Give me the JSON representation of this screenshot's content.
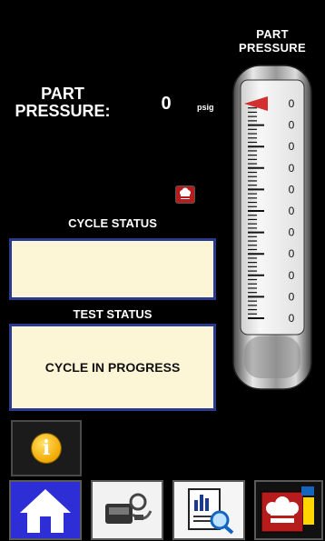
{
  "gauge": {
    "title_line1": "PART",
    "title_line2": "PRESSURE",
    "scale_labels": [
      "0",
      "0",
      "0",
      "0",
      "0",
      "0",
      "0",
      "0",
      "0",
      "0",
      "0"
    ]
  },
  "part_pressure": {
    "label_line1": "PART",
    "label_line2": "PRESSURE:",
    "value": "0",
    "unit": "psig"
  },
  "cycle_status": {
    "label": "CYCLE STATUS",
    "value": ""
  },
  "test_status": {
    "label": "TEST STATUS",
    "value": "CYCLE IN PROGRESS"
  },
  "colors": {
    "background": "#000000",
    "status_box_fill": "#fdf6d6",
    "status_box_border": "#2a3a8f",
    "gauge_pointer": "#d32f2f",
    "info_icon": "#f2a900",
    "home_button": "#2e2ed6",
    "chef_icon": "#b71c1c"
  },
  "icons": {
    "info": "info-icon",
    "home": "home-icon",
    "leak_test": "leak-tester-icon",
    "report": "report-search-icon",
    "chef": "chef-logo-icon"
  }
}
